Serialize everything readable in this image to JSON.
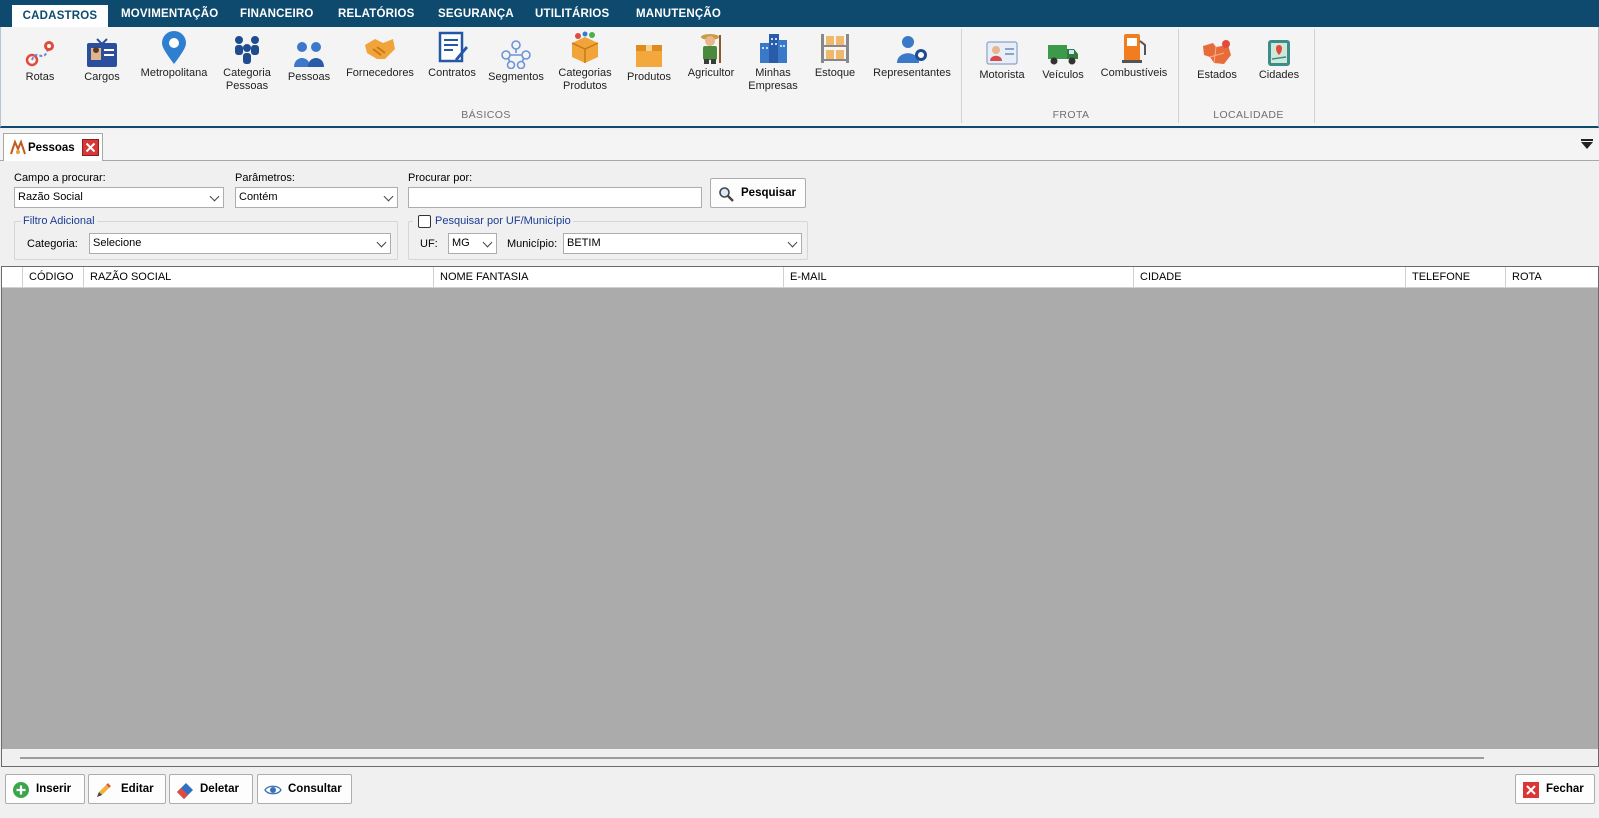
{
  "menu": {
    "tabs": [
      "CADASTROS",
      "MOVIMENTAÇÃO",
      "FINANCEIRO",
      "RELATÓRIOS",
      "SEGURANÇA",
      "UTILITÁRIOS",
      "MANUTENÇÃO"
    ],
    "active": "CADASTROS"
  },
  "ribbon": {
    "groups": {
      "basicos": "BÁSICOS",
      "frota": "FROTA",
      "localidade": "LOCALIDADE"
    },
    "buttons": {
      "rotas": "Rotas",
      "cargos": "Cargos",
      "metropolitana": "Metropolitana",
      "categoria_pessoas_1": "Categoria",
      "categoria_pessoas_2": "Pessoas",
      "pessoas": "Pessoas",
      "fornecedores": "Fornecedores",
      "contratos": "Contratos",
      "segmentos": "Segmentos",
      "categorias_produtos_1": "Categorias",
      "categorias_produtos_2": "Produtos",
      "produtos": "Produtos",
      "agricultor": "Agricultor",
      "minhas_empresas_1": "Minhas",
      "minhas_empresas_2": "Empresas",
      "estoque": "Estoque",
      "representantes": "Representantes",
      "motorista": "Motorista",
      "veiculos": "Veículos",
      "combustiveis": "Combustíveis",
      "estados": "Estados",
      "cidades": "Cidades"
    }
  },
  "doc_tab": {
    "label": "Pessoas"
  },
  "search": {
    "campo_label": "Campo a procurar:",
    "campo_value": "Razão Social",
    "param_label": "Parâmetros:",
    "param_value": "Contém",
    "procurar_label": "Procurar por:",
    "procurar_value": "",
    "pesquisar_button": "Pesquisar"
  },
  "filtro": {
    "legend": "Filtro Adicional",
    "categoria_label": "Categoria:",
    "categoria_value": "Selecione"
  },
  "uf_filter": {
    "legend": "Pesquisar por UF/Município",
    "checked": false,
    "uf_label": "UF:",
    "uf_value": "MG",
    "municipio_label": "Município:",
    "municipio_value": "BETIM"
  },
  "grid": {
    "columns": [
      "CÓDIGO",
      "RAZÃO SOCIAL",
      "NOME FANTASIA",
      "E-MAIL",
      "CIDADE",
      "TELEFONE",
      "ROTA"
    ],
    "rows": []
  },
  "actions": {
    "inserir": "Inserir",
    "editar": "Editar",
    "deletar": "Deletar",
    "consultar": "Consultar",
    "fechar": "Fechar"
  },
  "colors": {
    "menu_bar": "#0d4a6e",
    "grid_empty": "#ababab",
    "close_red": "#d93636"
  }
}
